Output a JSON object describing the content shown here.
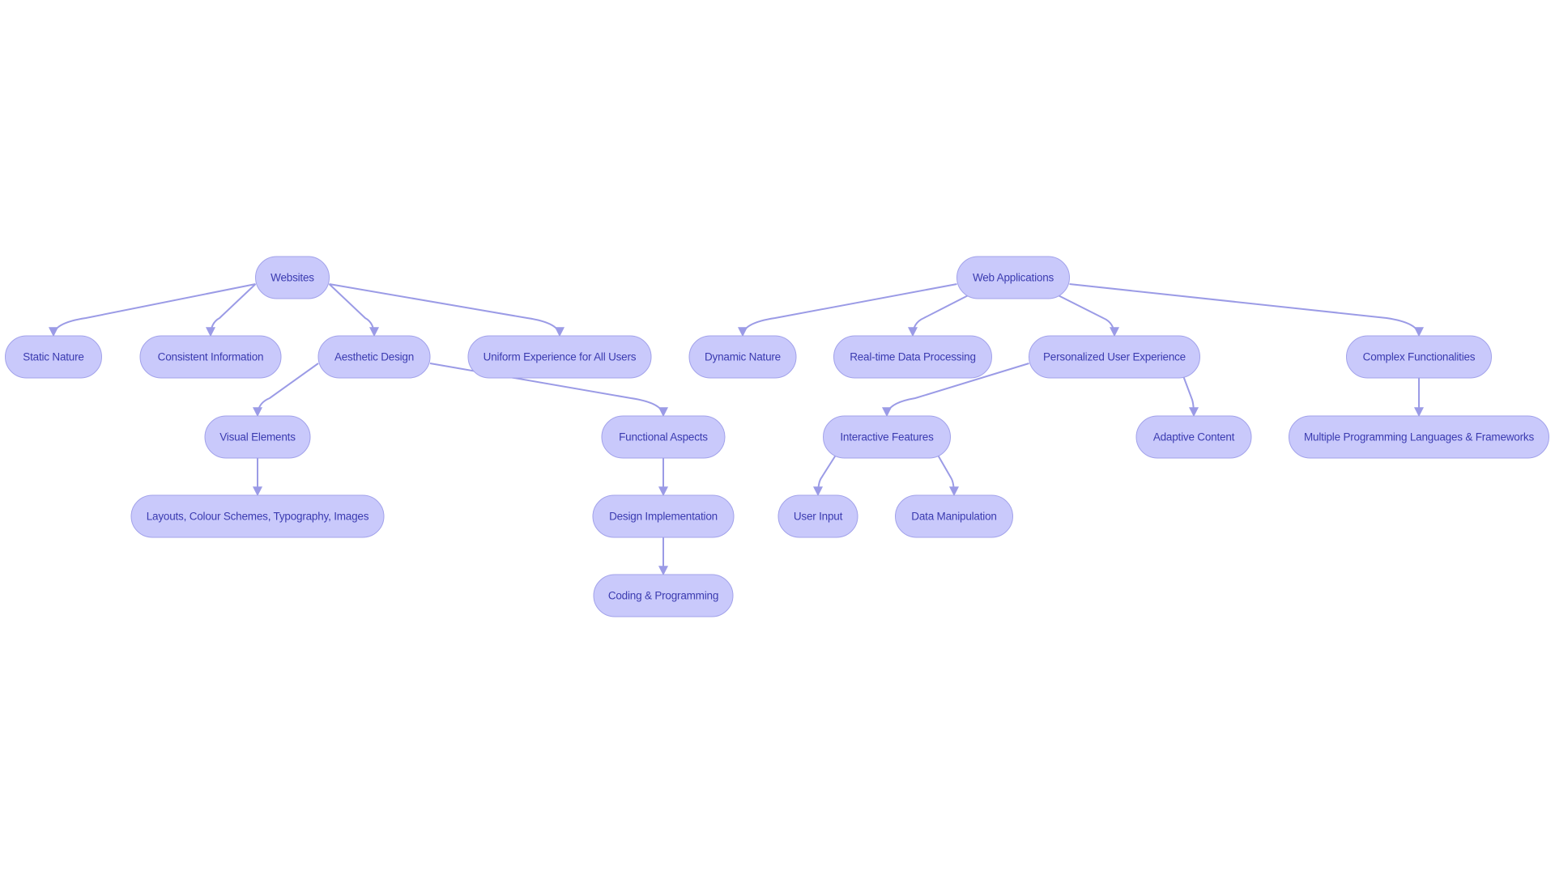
{
  "diagram": {
    "type": "flowchart",
    "colors": {
      "node_fill": "#c9c9fb",
      "node_border": "#a2a2ea",
      "text": "#3b3bb0",
      "edge": "#9b9be6"
    },
    "nodes": [
      {
        "id": "websites",
        "label": "Websites"
      },
      {
        "id": "static",
        "label": "Static Nature"
      },
      {
        "id": "consistent",
        "label": "Consistent Information"
      },
      {
        "id": "aesthetic",
        "label": "Aesthetic Design"
      },
      {
        "id": "uniform",
        "label": "Uniform Experience for All Users"
      },
      {
        "id": "visual",
        "label": "Visual Elements"
      },
      {
        "id": "layouts",
        "label": "Layouts, Colour Schemes, Typography, Images"
      },
      {
        "id": "functional",
        "label": "Functional Aspects"
      },
      {
        "id": "designimpl",
        "label": "Design Implementation"
      },
      {
        "id": "coding",
        "label": "Coding & Programming"
      },
      {
        "id": "webapps",
        "label": "Web Applications"
      },
      {
        "id": "dynamic",
        "label": "Dynamic Nature"
      },
      {
        "id": "realtime",
        "label": "Real-time Data Processing"
      },
      {
        "id": "personalized",
        "label": "Personalized User Experience"
      },
      {
        "id": "complex",
        "label": "Complex Functionalities"
      },
      {
        "id": "interactive",
        "label": "Interactive Features"
      },
      {
        "id": "adaptive",
        "label": "Adaptive Content"
      },
      {
        "id": "userinput",
        "label": "User Input"
      },
      {
        "id": "datamanip",
        "label": "Data Manipulation"
      },
      {
        "id": "multiple",
        "label": "Multiple Programming Languages & Frameworks"
      }
    ],
    "edges": [
      [
        "websites",
        "static"
      ],
      [
        "websites",
        "consistent"
      ],
      [
        "websites",
        "aesthetic"
      ],
      [
        "websites",
        "uniform"
      ],
      [
        "aesthetic",
        "visual"
      ],
      [
        "aesthetic",
        "functional"
      ],
      [
        "visual",
        "layouts"
      ],
      [
        "functional",
        "designimpl"
      ],
      [
        "designimpl",
        "coding"
      ],
      [
        "webapps",
        "dynamic"
      ],
      [
        "webapps",
        "realtime"
      ],
      [
        "webapps",
        "personalized"
      ],
      [
        "webapps",
        "complex"
      ],
      [
        "personalized",
        "interactive"
      ],
      [
        "personalized",
        "adaptive"
      ],
      [
        "interactive",
        "userinput"
      ],
      [
        "interactive",
        "datamanip"
      ],
      [
        "complex",
        "multiple"
      ]
    ]
  }
}
